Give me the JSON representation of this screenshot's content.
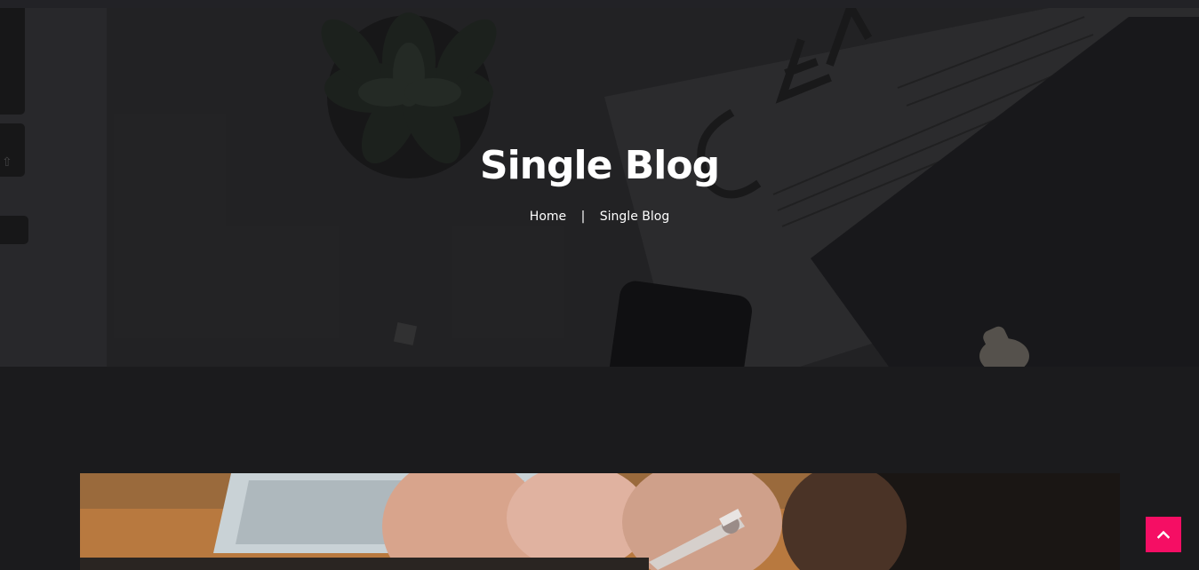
{
  "hero": {
    "title": "Single Blog",
    "breadcrumb": {
      "home_label": "Home",
      "separator": "|",
      "current_label": "Single Blog"
    }
  },
  "featured_image": {
    "alt": "Hands writing with a pen near a laptop"
  },
  "scroll_top": {
    "icon": "chevron-up-icon",
    "accent_color": "#f50e64"
  }
}
